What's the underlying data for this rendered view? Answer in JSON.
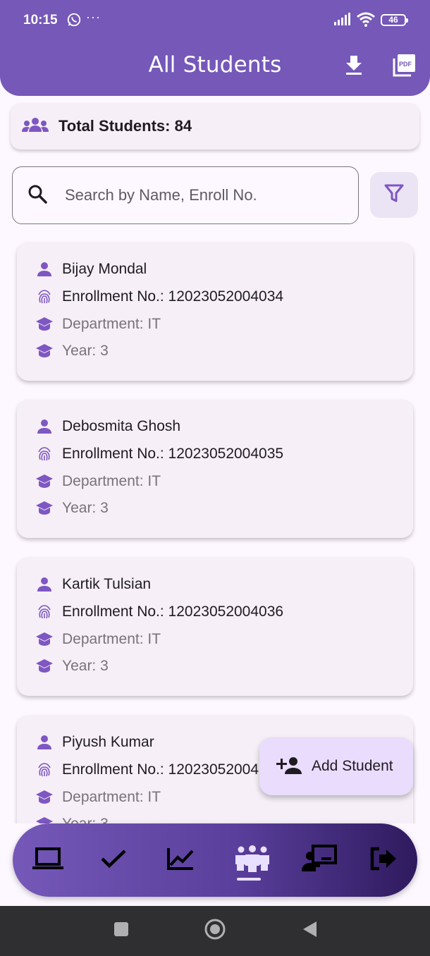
{
  "status_bar": {
    "time": "10:15",
    "dots": "···",
    "battery": "46"
  },
  "header": {
    "title": "All Students"
  },
  "summary": {
    "total_label": "Total Students: 84"
  },
  "search": {
    "placeholder": "Search by Name, Enroll No."
  },
  "students": [
    {
      "name": "Bijay Mondal",
      "enrollment": "Enrollment No.: 12023052004034",
      "department": "Department: IT",
      "year": "Year: 3"
    },
    {
      "name": "Debosmita Ghosh",
      "enrollment": "Enrollment No.: 12023052004035",
      "department": "Department: IT",
      "year": "Year: 3"
    },
    {
      "name": "Kartik Tulsian",
      "enrollment": "Enrollment No.: 12023052004036",
      "department": "Department: IT",
      "year": "Year: 3"
    },
    {
      "name": "Piyush Kumar",
      "enrollment": "Enrollment No.: 12023052004",
      "department": "Department: IT",
      "year": "Year: 3"
    }
  ],
  "fab": {
    "label": "Add Student"
  },
  "bottom_nav": {
    "items": [
      "laptop-icon",
      "check-icon",
      "chart-line-icon",
      "groups-icon",
      "presenter-icon",
      "logout-icon"
    ],
    "active": "groups-icon"
  },
  "colors": {
    "primary": "#7558b8",
    "card": "#f6eff7",
    "icon": "#7e57c2",
    "fab": "#eadcfc"
  }
}
